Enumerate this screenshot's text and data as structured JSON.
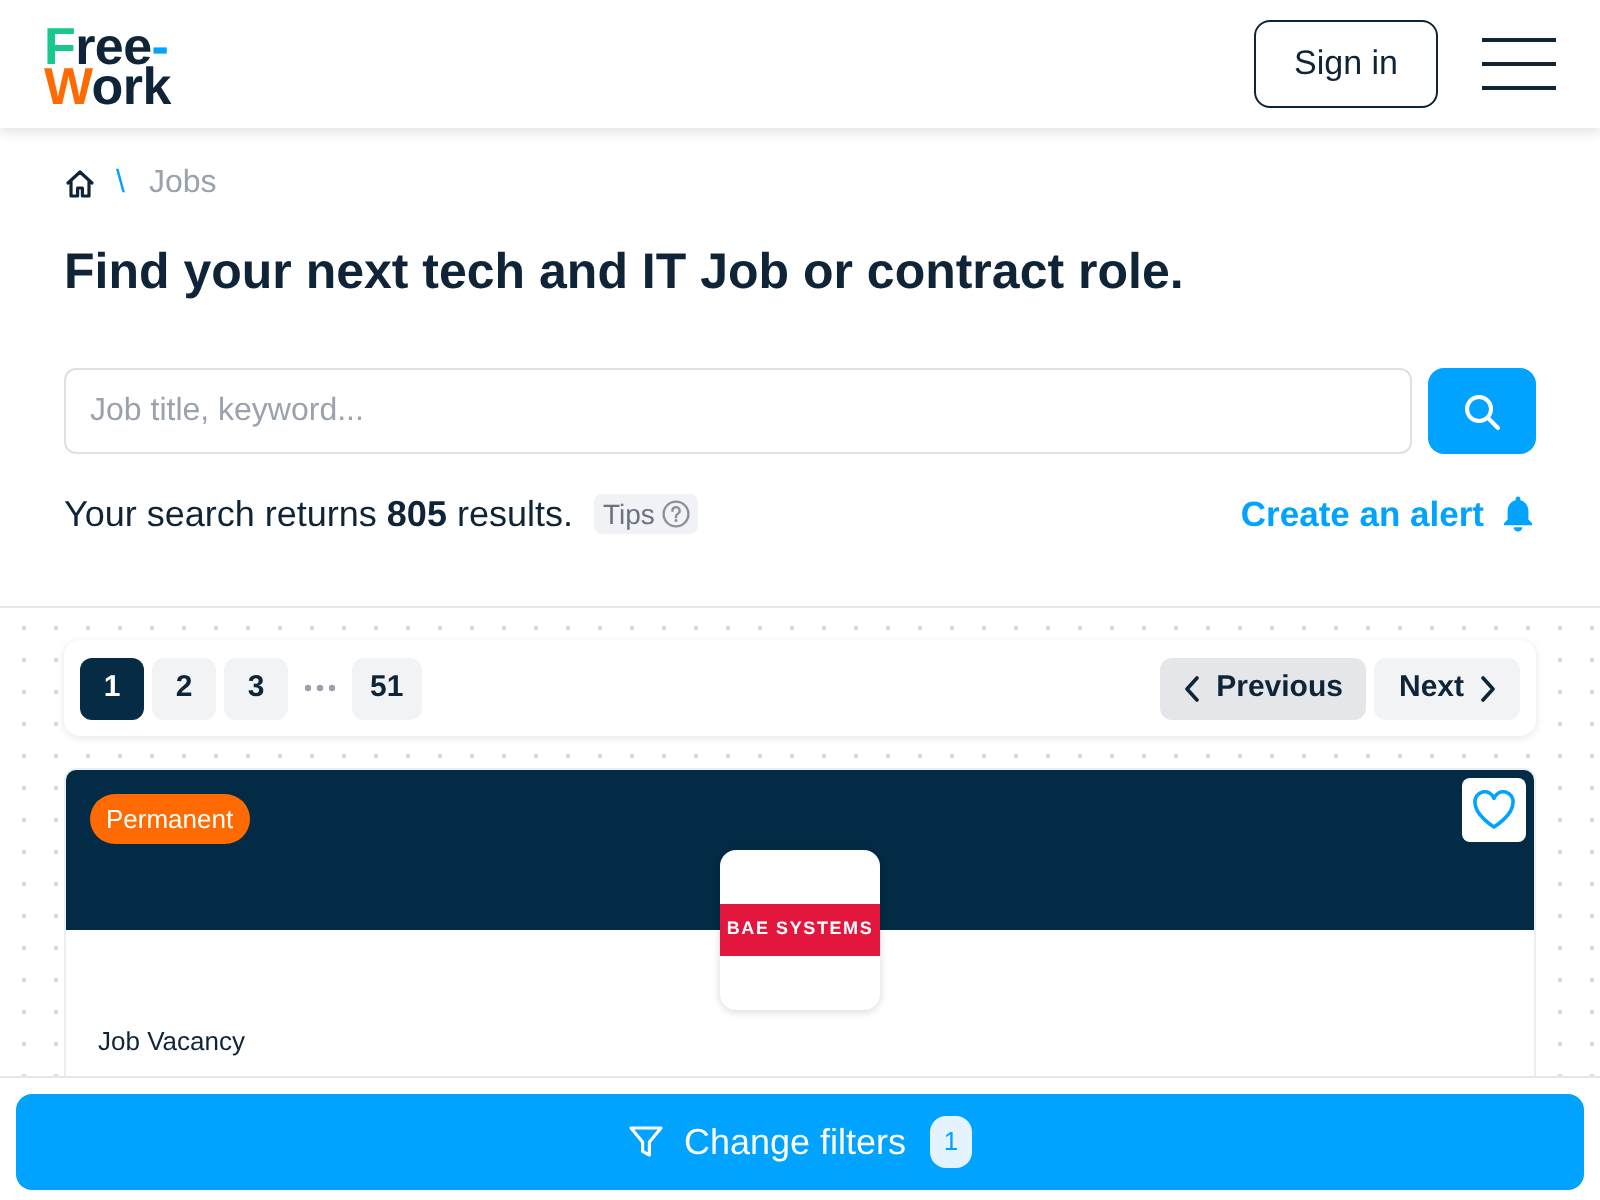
{
  "header": {
    "logo": {
      "lines": [
        "Free-",
        "Work"
      ]
    },
    "sign_in_button": "Sign in"
  },
  "breadcrumb": {
    "separator": "\\",
    "items": [
      "Jobs"
    ]
  },
  "heading": "Find your next tech and IT Job or contract role.",
  "search": {
    "placeholder": "Job title, keyword..."
  },
  "results": {
    "text": "Your search returns **805** results.",
    "tips_button": "Tips",
    "create_alert_link": "Create an alert"
  },
  "pagination": {
    "pages": [
      {
        "kind": "page",
        "label": "1",
        "selected": true
      },
      {
        "kind": "page",
        "label": "2",
        "selected": false
      },
      {
        "kind": "page",
        "label": "3",
        "selected": false
      },
      {
        "kind": "gap"
      },
      {
        "kind": "page",
        "label": "51",
        "selected": false
      }
    ],
    "previous": {
      "label": "Previous",
      "highlighted": true
    },
    "next": {
      "label": "Next",
      "highlighted": false
    }
  },
  "job_card": {
    "tag": "Permanent",
    "saved": false,
    "company_logo_text": "BAE SYSTEMS",
    "type_label": "Job Vacancy"
  },
  "bottom_bar": {
    "button": "Change filters",
    "filter_count": "1"
  }
}
